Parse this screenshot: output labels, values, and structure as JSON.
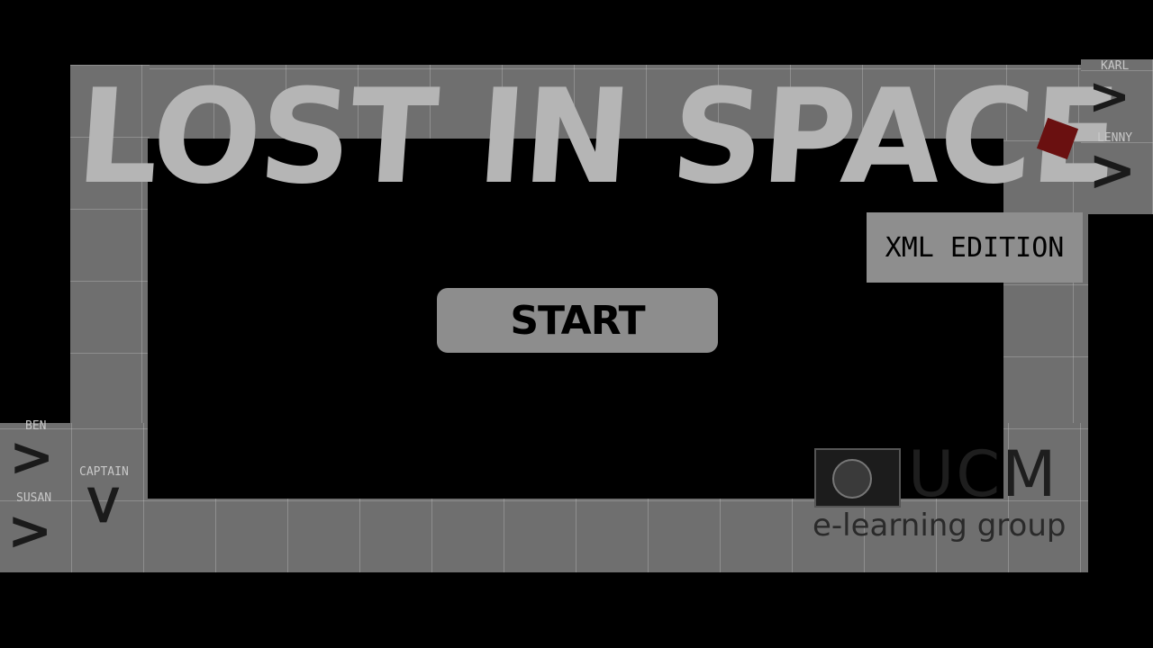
{
  "game": {
    "title": "LOST IN SPACE",
    "edition": "XML EDITION",
    "start_label": "START"
  },
  "characters": {
    "karl": "KARL",
    "lenny": "LENNY",
    "ben": "BEN",
    "susan": "SUSAN",
    "captain": "CAPTAIN"
  },
  "logo": {
    "name": "UCM",
    "subtitle": "e-learning group"
  },
  "colors": {
    "background": "#000000",
    "track": "#6f6f6f",
    "title": "#b5b5b5",
    "button": "#8d8d8d"
  }
}
